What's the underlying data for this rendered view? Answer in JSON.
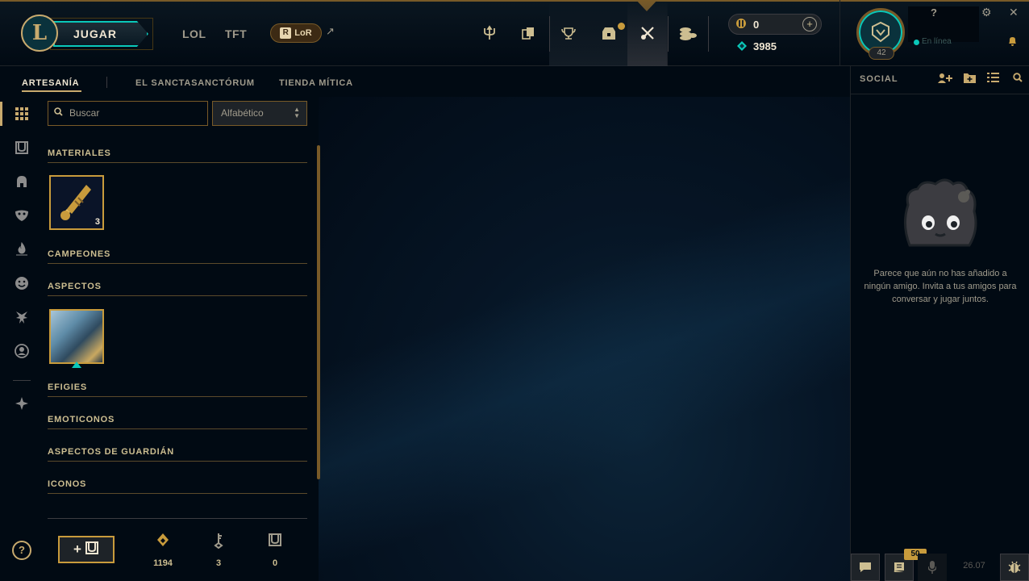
{
  "header": {
    "play_label": "JUGAR",
    "nav_links": [
      "LOL",
      "TFT"
    ],
    "lor_label": "LoR",
    "lor_ext": "↗",
    "rp_value": "0",
    "be_value": "3985",
    "level": "42",
    "status_text": "En línea",
    "help_label": "?",
    "nav_icons": [
      "trident-icon",
      "cards-icon",
      "trophy-icon",
      "loot-chest-icon",
      "crafting-icon",
      "store-icon"
    ]
  },
  "subnav": {
    "tabs": [
      "ARTESANÍA",
      "EL SANCTASANCTÓRUM",
      "TIENDA MÍTICA"
    ]
  },
  "filters": {
    "search_placeholder": "Buscar",
    "sort_value": "Alfabético"
  },
  "categories": [
    "MATERIALES",
    "CAMPEONES",
    "ASPECTOS",
    "EFIGIES",
    "EMOTICONOS",
    "ASPECTOS DE GUARDIÁN",
    "ICONOS"
  ],
  "items": {
    "key_fragment_count": "3"
  },
  "footer": {
    "forge_label": "+",
    "stats": [
      {
        "icon": "orange-essence-icon",
        "value": "1194"
      },
      {
        "icon": "key-icon",
        "value": "3"
      },
      {
        "icon": "chest-icon",
        "value": "0"
      }
    ]
  },
  "social": {
    "title": "SOCIAL",
    "empty_message": "Parece que aún no has añadido a ningún amigo. Invita a tus amigos para conversar y jugar juntos.",
    "mission_badge": "50",
    "patch": "26.07"
  },
  "colors": {
    "gold": "#c8aa6e",
    "teal": "#0ac8b9",
    "background": "#010a13"
  }
}
